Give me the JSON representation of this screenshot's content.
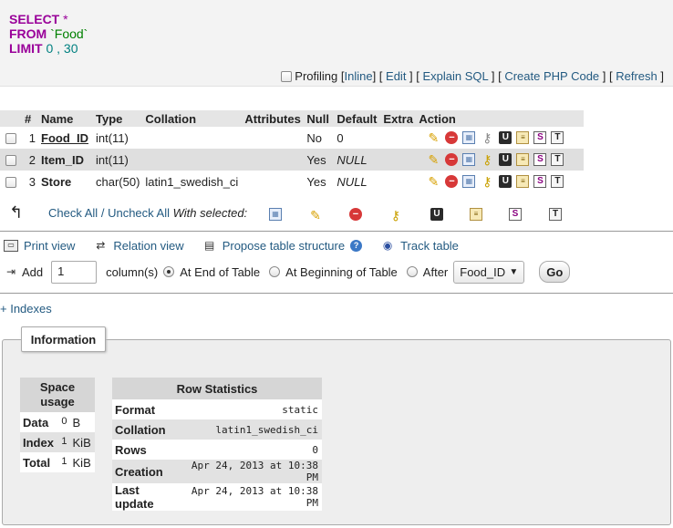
{
  "sql": {
    "select_kw": "SELECT",
    "select_star": "*",
    "from_kw": "FROM",
    "table": "`Food`",
    "limit_kw": "LIMIT",
    "offset": "0",
    "comma": ",",
    "count": "30"
  },
  "sql_tools": {
    "profiling": "Profiling",
    "inline": "Inline",
    "edit": "Edit",
    "explain": "Explain SQL",
    "create_php": "Create PHP Code",
    "refresh": "Refresh"
  },
  "structure": {
    "headers": {
      "num": "#",
      "name": "Name",
      "type": "Type",
      "collation": "Collation",
      "attributes": "Attributes",
      "null": "Null",
      "default": "Default",
      "extra": "Extra",
      "action": "Action"
    },
    "rows": [
      {
        "num": "1",
        "name": "Food_ID",
        "type": "int(11)",
        "collation": "",
        "attributes": "",
        "null": "No",
        "default": "0",
        "extra": ""
      },
      {
        "num": "2",
        "name": "Item_ID",
        "type": "int(11)",
        "collation": "",
        "attributes": "",
        "null": "Yes",
        "default": "NULL",
        "extra": ""
      },
      {
        "num": "3",
        "name": "Store",
        "type": "char(50)",
        "collation": "latin1_swedish_ci",
        "attributes": "",
        "null": "Yes",
        "default": "NULL",
        "extra": ""
      }
    ]
  },
  "selection": {
    "check_all": "Check All",
    "separator": "/",
    "uncheck_all": "Uncheck All",
    "with_selected": "With selected:"
  },
  "links": {
    "print_view": "Print view",
    "relation_view": "Relation view",
    "propose": "Propose table structure",
    "track": "Track table"
  },
  "add": {
    "label": "Add",
    "count": "1",
    "columns": "column(s)",
    "at_end": "At End of Table",
    "at_beginning": "At Beginning of Table",
    "after": "After",
    "after_field": "Food_ID",
    "go": "Go"
  },
  "indexes_link": "+ Indexes",
  "information": {
    "legend": "Information",
    "space": {
      "header": "Space usage",
      "rows": [
        {
          "label": "Data",
          "value": "0",
          "unit": "B"
        },
        {
          "label": "Index",
          "value": "1",
          "unit": "KiB"
        },
        {
          "label": "Total",
          "value": "1",
          "unit": "KiB"
        }
      ]
    },
    "stats": {
      "header": "Row Statistics",
      "rows": [
        {
          "label": "Format",
          "value": "static"
        },
        {
          "label": "Collation",
          "value": "latin1_swedish_ci"
        },
        {
          "label": "Rows",
          "value": "0"
        },
        {
          "label": "Creation",
          "value": "Apr 24, 2013 at 10:38 PM"
        },
        {
          "label": "Last update",
          "value": "Apr 24, 2013 at 10:38 PM"
        }
      ]
    }
  },
  "icons": [
    "pencil-icon",
    "drop-icon",
    "browse-icon",
    "key-icon",
    "unique-icon",
    "index-icon",
    "spatial-icon",
    "fulltext-icon",
    "print-icon",
    "relation-icon",
    "propose-icon",
    "help-icon",
    "eye-icon",
    "add-column-icon",
    "arrow-icon"
  ]
}
